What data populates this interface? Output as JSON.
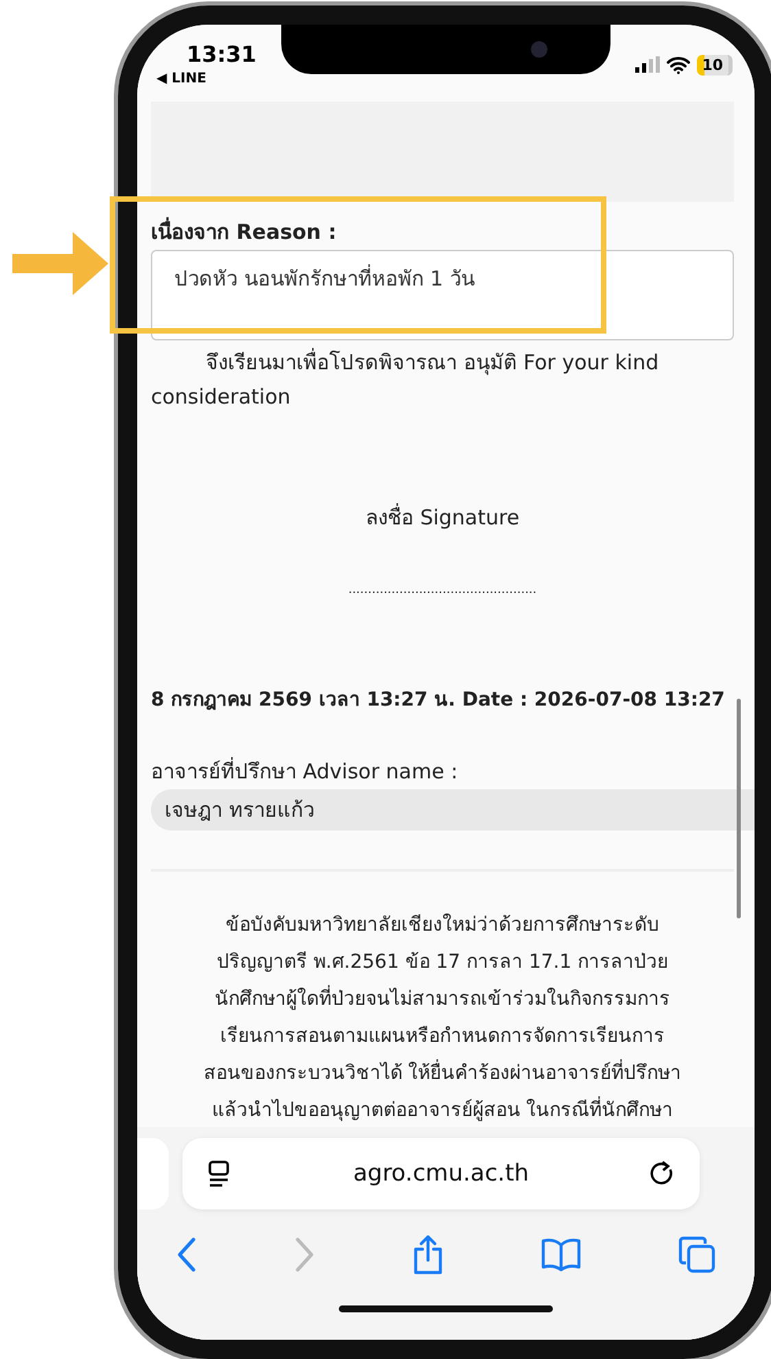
{
  "status_bar": {
    "time": "13:31",
    "back_app": "◀ LINE",
    "battery": "10",
    "low_power_mode": true
  },
  "form": {
    "reason_label": "เนื่องจาก Reason :",
    "reason_value": "ปวดหัว นอนพักรักษาที่หอพัก 1 วัน",
    "request_text": "จึงเรียนมาเพื่อโปรดพิจารณา อนุมัติ For your kind consideration",
    "signature_label": "ลงชื่อ Signature",
    "signature_line": "................................................",
    "date_text": "8 กรกฎาคม 2569 เวลา 13:27 น. Date : 2026-07-08 13:27",
    "advisor_label": "อาจารย์ที่ปรึกษา Advisor name :",
    "advisor_value": "เจษฎา  ทรายแก้ว",
    "regulation_text": "ข้อบังคับมหาวิทยาลัยเชียงใหม่ว่าด้วยการศึกษาระดับ\nปริญญาตรี พ.ศ.2561 ข้อ 17 การลา 17.1 การลาป่วย\nนักศึกษาผู้ใดที่ป่วยจนไม่สามารถเข้าร่วมในกิจกรรมการ\nเรียนการสอนตามแผนหรือกำหนดการจัดการเรียนการ\nสอนของกระบวนวิชาได้ ให้ยื่นคำร้องผ่านอาจารย์ที่ปรึกษา\nแล้วนำไปขออนุญาตต่ออาจารย์ผู้สอน ในกรณีที่นักศึกษา"
  },
  "browser": {
    "url": "agro.cmu.ac.th",
    "back_disabled": false,
    "forward_disabled": true
  },
  "annotation": {
    "highlighted": true
  }
}
